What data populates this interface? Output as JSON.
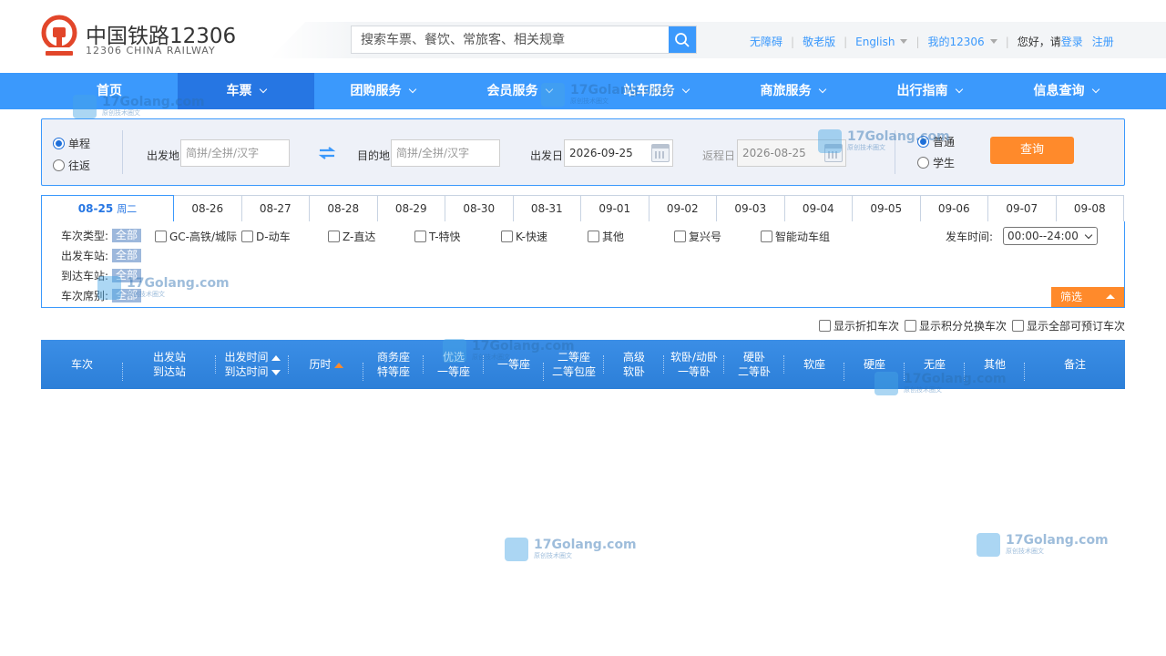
{
  "brand": {
    "name_cn": "中国铁路12306",
    "name_en": "12306 CHINA RAILWAY",
    "color": "#e2462a"
  },
  "search": {
    "placeholder": "搜索车票、餐饮、常旅客、相关规章"
  },
  "toplinks": {
    "accessible": "无障碍",
    "elder": "敬老版",
    "english": "English",
    "my12306": "我的12306",
    "greeting": "您好，请",
    "login": "登录",
    "register": "注册"
  },
  "nav": {
    "items": [
      {
        "label": "首页"
      },
      {
        "label": "车票"
      },
      {
        "label": "团购服务"
      },
      {
        "label": "会员服务"
      },
      {
        "label": "站车服务"
      },
      {
        "label": "商旅服务"
      },
      {
        "label": "出行指南"
      },
      {
        "label": "信息查询"
      }
    ]
  },
  "query": {
    "one_way": "单程",
    "round_trip": "往返",
    "from_label": "出发地",
    "from_placeholder": "简拼/全拼/汉字",
    "to_label": "目的地",
    "to_placeholder": "简拼/全拼/汉字",
    "depart_label": "出发日",
    "depart_date": "2026-09-25",
    "return_label": "返程日",
    "return_date": "2026-08-25",
    "normal": "普通",
    "student": "学生",
    "submit": "查询"
  },
  "date_tabs": {
    "active_date": "08-25",
    "active_weekday": "周二",
    "dates": [
      "08-26",
      "08-27",
      "08-28",
      "08-29",
      "08-30",
      "08-31",
      "09-01",
      "09-02",
      "09-03",
      "09-04",
      "09-05",
      "09-06",
      "09-07",
      "09-08"
    ]
  },
  "filters": {
    "train_type_label": "车次类型:",
    "depart_station_label": "出发车站:",
    "arrive_station_label": "到达车站:",
    "seat_label": "车次席别:",
    "all": "全部",
    "types": [
      "GC-高铁/城际",
      "D-动车",
      "Z-直达",
      "T-特快",
      "K-快速",
      "其他",
      "复兴号",
      "智能动车组"
    ],
    "time_label": "发车时间:",
    "time_value": "00:00--24:00",
    "filter_button": "筛选"
  },
  "options": [
    "显示折扣车次",
    "显示积分兑换车次",
    "显示全部可预订车次"
  ],
  "table_header": {
    "train": "车次",
    "station_1": "出发站",
    "station_2": "到达站",
    "time_1": "出发时间",
    "time_2": "到达时间",
    "duration": "历时",
    "business_1": "商务座",
    "business_2": "特等座",
    "premium_1": "优选",
    "premium_2": "一等座",
    "first": "一等座",
    "second_1": "二等座",
    "second_2": "二等包座",
    "superior_1": "高级",
    "superior_2": "软卧",
    "soft_sleeper_1": "软卧/动卧",
    "soft_sleeper_2": "一等卧",
    "hard_sleeper_1": "硬卧",
    "hard_sleeper_2": "二等卧",
    "soft_seat": "软座",
    "hard_seat": "硬座",
    "no_seat": "无座",
    "other": "其他",
    "note": "备注"
  },
  "watermark": {
    "text": "17Golang.com",
    "sub": "原创技术圈文"
  },
  "colors": {
    "primary": "#3b99fc",
    "nav_active": "#2676e3",
    "accent_orange": "#ff8a2b",
    "panel_bg": "#eef1f8"
  }
}
